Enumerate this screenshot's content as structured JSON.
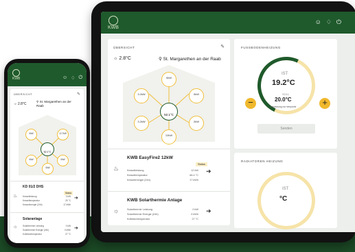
{
  "tablet": {
    "brand": "KWB",
    "overview": {
      "title": "Übersicht",
      "temperature": "2.8°C",
      "location": "St. Margarethen an der Raab",
      "nodes": [
        {
          "name": "node-top",
          "value": "0kW"
        },
        {
          "name": "node-left-top",
          "value": "3.2kW"
        },
        {
          "name": "node-right-top",
          "value": "0kW"
        },
        {
          "name": "node-left-bottom",
          "value": "3.2kW"
        },
        {
          "name": "node-right-bottom",
          "value": "2kW"
        },
        {
          "name": "node-bottom",
          "value": "12kW"
        }
      ],
      "center": "52.1°C"
    },
    "boiler": {
      "title": "KWB EasyFire2 12kW",
      "badge": "Status",
      "rows": [
        {
          "label": "Kesselleistung",
          "value": "12 kW"
        },
        {
          "label": "Kesseltemperatur",
          "value": "66.4 °C"
        },
        {
          "label": "Kesselenergie (24h)",
          "value": "17 kWh"
        }
      ]
    },
    "solar": {
      "title": "KWB Solarthermie Anlage",
      "rows": [
        {
          "label": "Solarthermie Leistung",
          "value": "0 kW"
        },
        {
          "label": "Solarthermie Energie (24h)",
          "value": "0 kWh"
        },
        {
          "label": "Kollektortemperatur",
          "value": "27 °C"
        }
      ]
    },
    "floor_heating": {
      "title": "Fußbodenheizung",
      "ist_label": "IST",
      "ist_value": "19.2°C",
      "soll_label": "SOLL",
      "soll_value": "20.0°C",
      "note": "Anpassung nur temporär",
      "minus": "−",
      "plus": "+",
      "button": "Senden"
    },
    "radiator": {
      "title": "Radiatoren Heizung",
      "ist_label": "IST",
      "ist_value": "°C"
    }
  },
  "phone": {
    "brand": "KWB",
    "overview": {
      "title": "Übersicht",
      "temperature": "2.8°C",
      "location": "St. Margarethen an der Raab",
      "nodes": [
        {
          "name": "node-left",
          "value": "0kW"
        },
        {
          "name": "node-right",
          "value": "12.7kW"
        },
        {
          "name": "node-left-bottom",
          "value": "0kW"
        },
        {
          "name": "node-right-bottom",
          "value": "0kW"
        },
        {
          "name": "node-bottom",
          "value": "0kW"
        }
      ],
      "center": "52.1°C"
    },
    "boiler": {
      "title": "KD 01/2 DHS",
      "badge": "Status",
      "rows": [
        {
          "label": "Kesselleistung",
          "value": "0 kW"
        },
        {
          "label": "Kesseltemperatur",
          "value": "25 °C"
        },
        {
          "label": "Kesselenergie (24h)",
          "value": "17 kWh"
        }
      ]
    },
    "solar": {
      "title": "Solaranlage",
      "rows": [
        {
          "label": "Solarthermie Leistung",
          "value": "0 kW"
        },
        {
          "label": "Solarthermie Energie (24h)",
          "value": "0 kWh"
        },
        {
          "label": "Kollektortemperatur",
          "value": "27 °C"
        }
      ]
    }
  },
  "colors": {
    "brand_green": "#1f5a2c",
    "accent_yellow": "#f0b82c",
    "band": "#1c4a26"
  },
  "icons": [
    "user-icon",
    "bell-icon",
    "power-icon",
    "edit-icon",
    "sun-icon",
    "location-icon",
    "chevron-right-icon"
  ]
}
